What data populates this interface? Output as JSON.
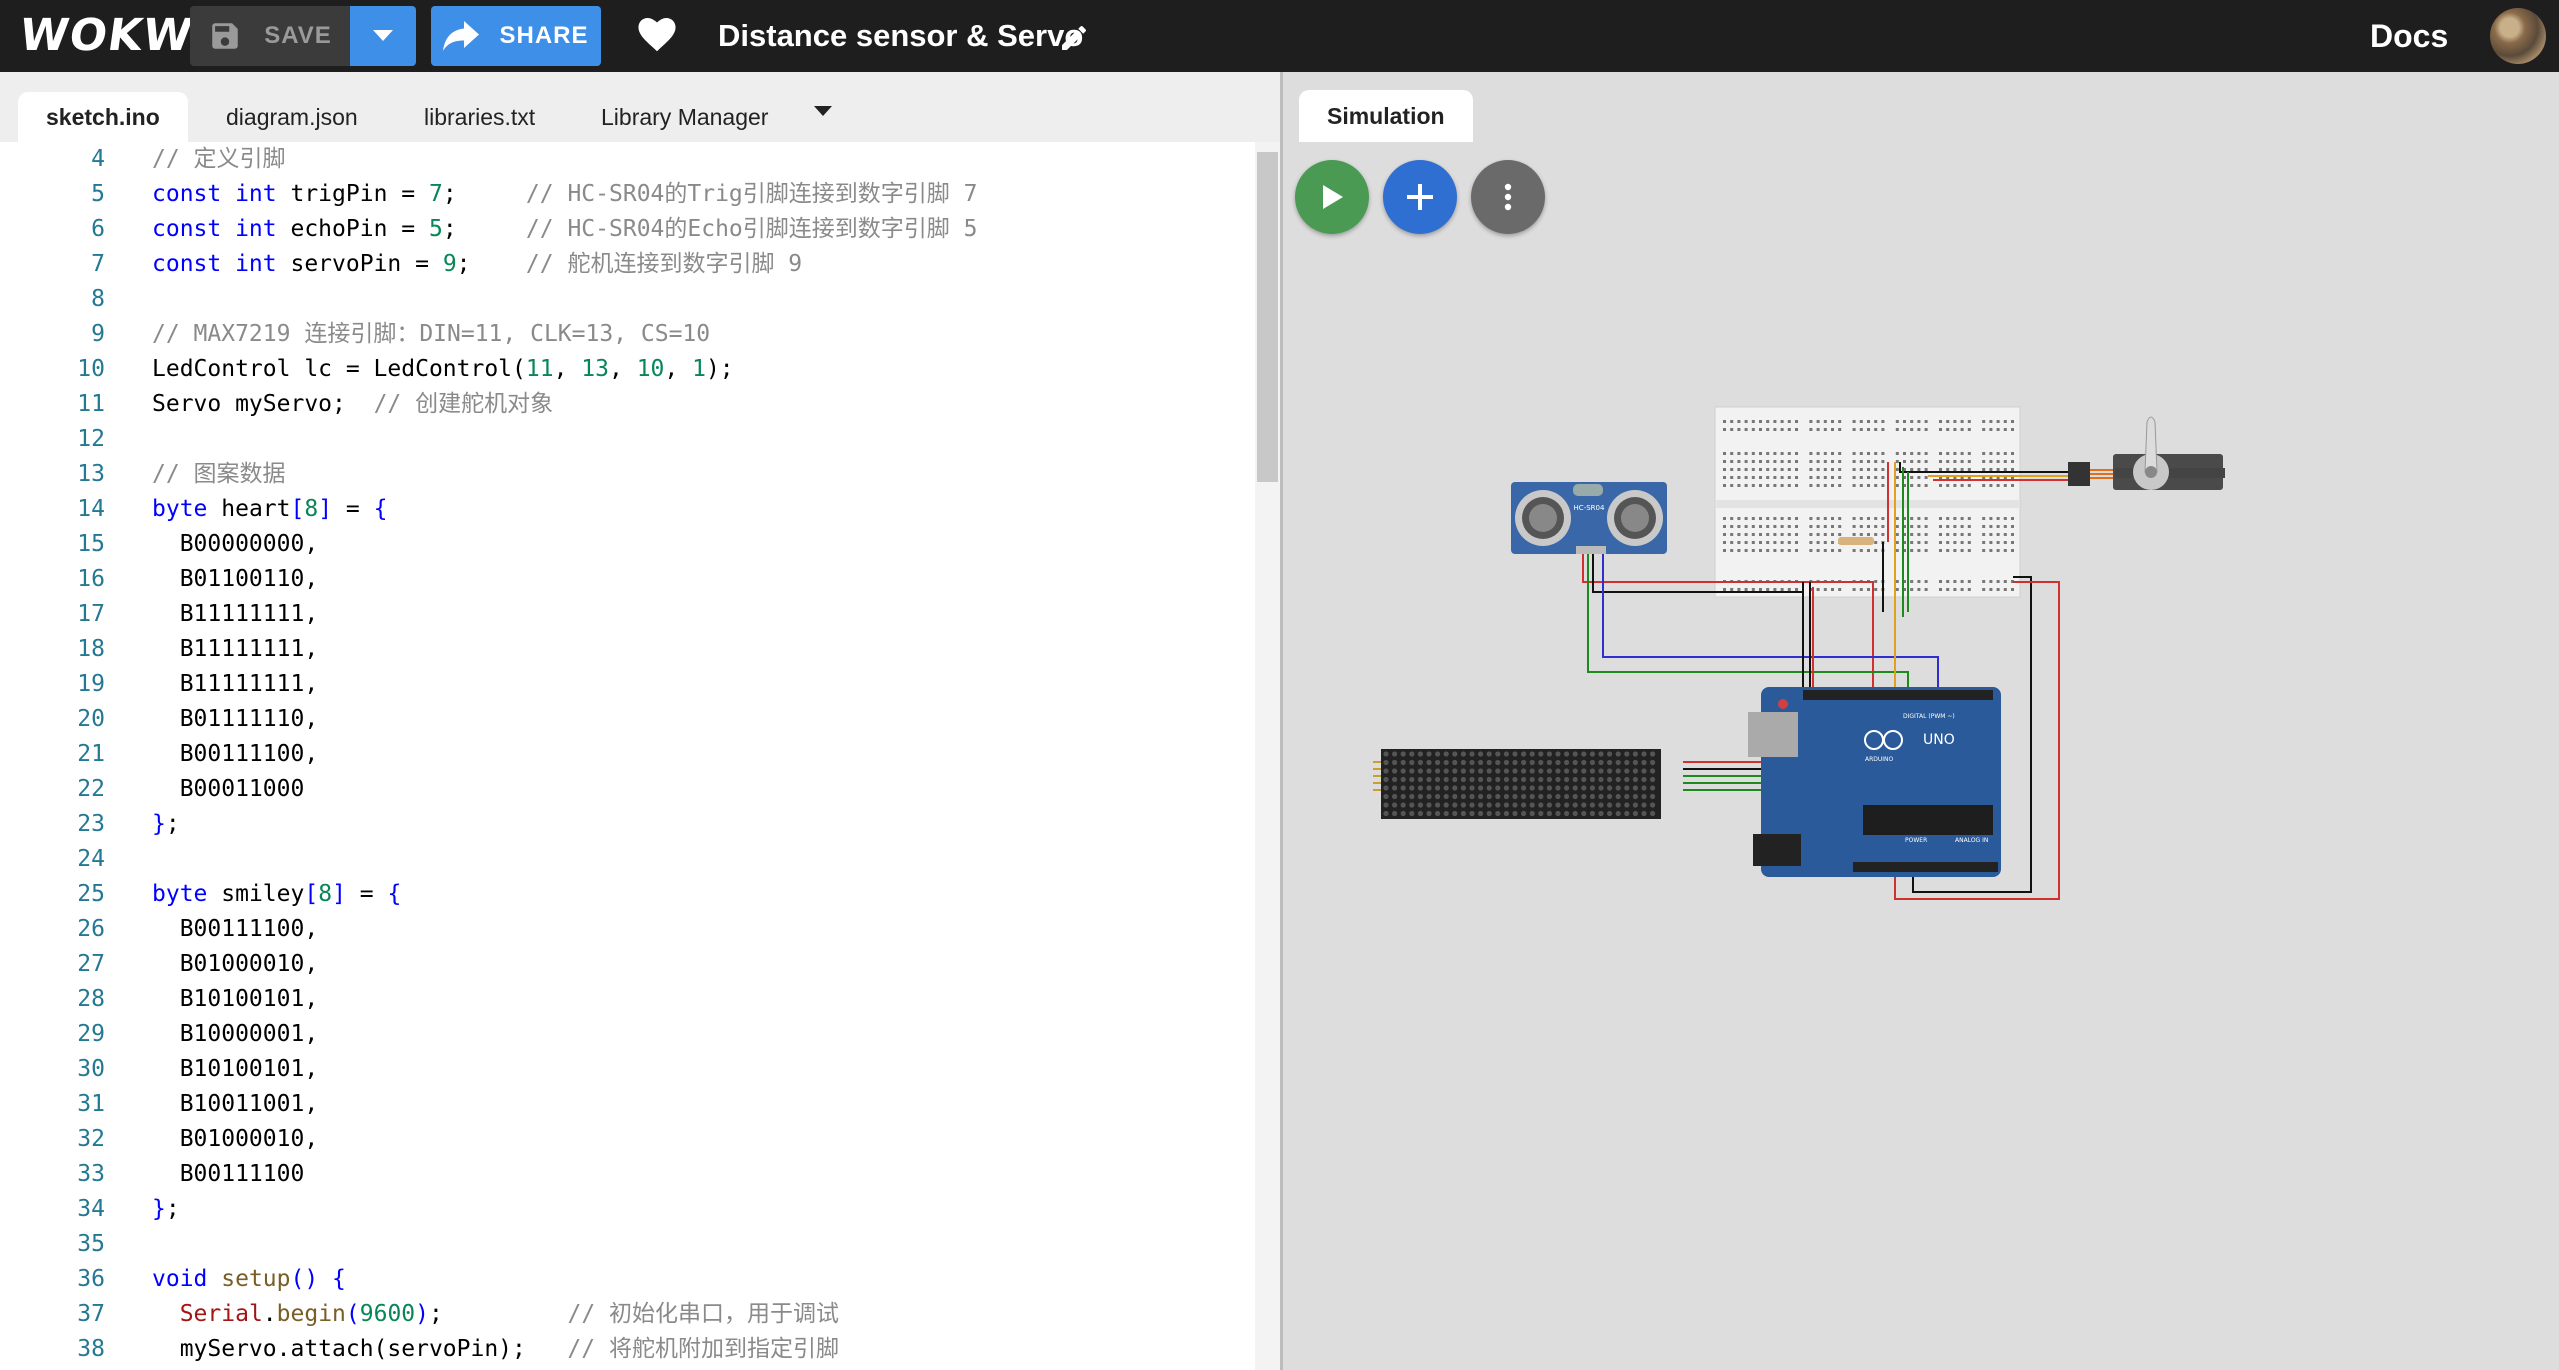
{
  "topbar": {
    "logo": "WOKWI",
    "save_label": "SAVE",
    "share_label": "SHARE",
    "project_title": "Distance sensor & Servo",
    "docs_label": "Docs"
  },
  "editor": {
    "tabs": [
      "sketch.ino",
      "diagram.json",
      "libraries.txt",
      "Library Manager"
    ],
    "active_tab": "sketch.ino",
    "first_line": 4,
    "lines": [
      [
        [
          "com",
          "// 定义引脚"
        ]
      ],
      [
        [
          "kw",
          "const int "
        ],
        [
          "",
          "trigPin = "
        ],
        [
          "num",
          "7"
        ],
        [
          "",
          ";     "
        ],
        [
          "com",
          "// HC-SR04的Trig引脚连接到数字引脚 7"
        ]
      ],
      [
        [
          "kw",
          "const int "
        ],
        [
          "",
          "echoPin = "
        ],
        [
          "num",
          "5"
        ],
        [
          "",
          ";     "
        ],
        [
          "com",
          "// HC-SR04的Echo引脚连接到数字引脚 5"
        ]
      ],
      [
        [
          "kw",
          "const int "
        ],
        [
          "",
          "servoPin = "
        ],
        [
          "num",
          "9"
        ],
        [
          "",
          ";    "
        ],
        [
          "com",
          "// 舵机连接到数字引脚 9"
        ]
      ],
      [],
      [
        [
          "com",
          "// MAX7219 连接引脚：DIN=11, CLK=13, CS=10"
        ]
      ],
      [
        [
          "",
          "LedControl lc = LedControl("
        ],
        [
          "num",
          "11"
        ],
        [
          "",
          ", "
        ],
        [
          "num",
          "13"
        ],
        [
          "",
          ", "
        ],
        [
          "num",
          "10"
        ],
        [
          "",
          ", "
        ],
        [
          "num",
          "1"
        ],
        [
          "",
          ");"
        ]
      ],
      [
        [
          "",
          "Servo myServo;  "
        ],
        [
          "com",
          "// 创建舵机对象"
        ]
      ],
      [],
      [
        [
          "com",
          "// 图案数据"
        ]
      ],
      [
        [
          "kw",
          "byte "
        ],
        [
          "",
          "heart"
        ],
        [
          "kw",
          "["
        ],
        [
          "num",
          "8"
        ],
        [
          "kw",
          "]"
        ],
        [
          "",
          " = "
        ],
        [
          "kw",
          "{"
        ]
      ],
      [
        [
          "",
          "  B00000000,"
        ]
      ],
      [
        [
          "",
          "  B01100110,"
        ]
      ],
      [
        [
          "",
          "  B11111111,"
        ]
      ],
      [
        [
          "",
          "  B11111111,"
        ]
      ],
      [
        [
          "",
          "  B11111111,"
        ]
      ],
      [
        [
          "",
          "  B01111110,"
        ]
      ],
      [
        [
          "",
          "  B00111100,"
        ]
      ],
      [
        [
          "",
          "  B00011000"
        ]
      ],
      [
        [
          "kw",
          "}"
        ],
        [
          "",
          ";"
        ]
      ],
      [],
      [
        [
          "kw",
          "byte "
        ],
        [
          "",
          "smiley"
        ],
        [
          "kw",
          "["
        ],
        [
          "num",
          "8"
        ],
        [
          "kw",
          "]"
        ],
        [
          "",
          " = "
        ],
        [
          "kw",
          "{"
        ]
      ],
      [
        [
          "",
          "  B00111100,"
        ]
      ],
      [
        [
          "",
          "  B01000010,"
        ]
      ],
      [
        [
          "",
          "  B10100101,"
        ]
      ],
      [
        [
          "",
          "  B10000001,"
        ]
      ],
      [
        [
          "",
          "  B10100101,"
        ]
      ],
      [
        [
          "",
          "  B10011001,"
        ]
      ],
      [
        [
          "",
          "  B01000010,"
        ]
      ],
      [
        [
          "",
          "  B00111100"
        ]
      ],
      [
        [
          "kw",
          "}"
        ],
        [
          "",
          ";"
        ]
      ],
      [],
      [
        [
          "kw",
          "void "
        ],
        [
          "fn",
          "setup"
        ],
        [
          "kw",
          "() {"
        ]
      ],
      [
        [
          "",
          "  "
        ],
        [
          "cls",
          "Serial"
        ],
        [
          "",
          "."
        ],
        [
          "fn",
          "begin"
        ],
        [
          "kw",
          "("
        ],
        [
          "num",
          "9600"
        ],
        [
          "kw",
          ")"
        ],
        [
          "",
          ";         "
        ],
        [
          "com",
          "// 初始化串口，用于调试"
        ]
      ],
      [
        [
          "",
          "  myServo.attach(servoPin);   "
        ],
        [
          "com",
          "// 将舵机附加到指定引脚"
        ]
      ]
    ]
  },
  "simulation": {
    "tab_label": "Simulation",
    "components": {
      "ultrasonic_label": "HC-SR04",
      "arduino_label": "UNO",
      "arduino_brand": "ARDUINO",
      "arduino_digital": "DIGITAL (PWM ~)",
      "arduino_power": "POWER",
      "arduino_analog": "ANALOG IN"
    }
  },
  "colors": {
    "topbar": "#1e1e1e",
    "accent_blue": "#3d8fe8",
    "play_green": "#4a9a53",
    "add_blue": "#2f6fd1",
    "arduino_blue": "#2a5a9a"
  },
  "icons": [
    "save-icon",
    "chevron-down-icon",
    "share-icon",
    "heart-icon",
    "pencil-icon",
    "play-icon",
    "plus-icon",
    "kebab-icon"
  ]
}
